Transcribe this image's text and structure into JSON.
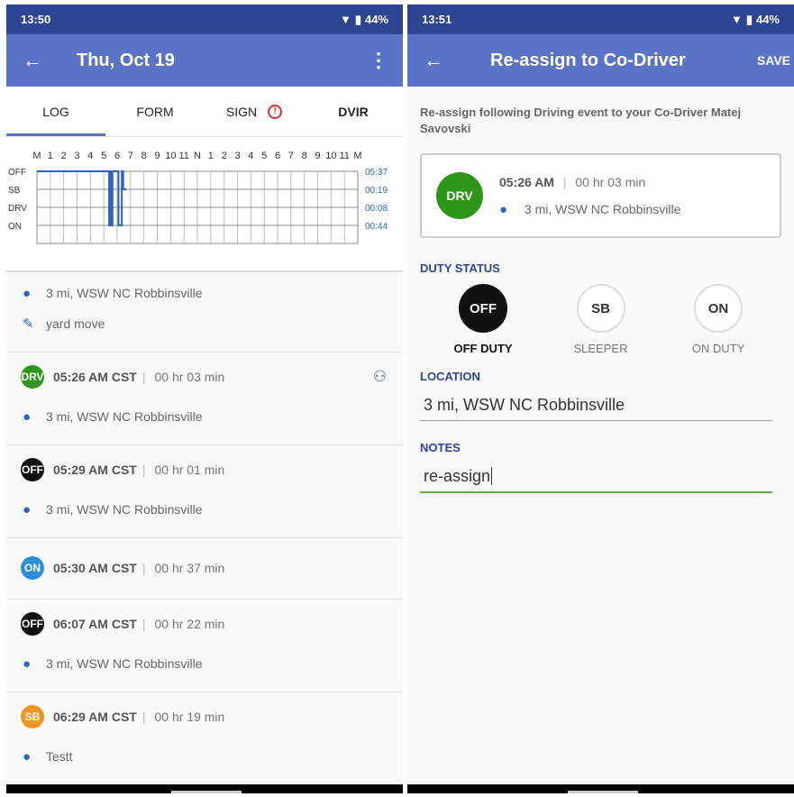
{
  "left": {
    "status_time": "13:50",
    "battery": "44%",
    "title": "Thu, Oct 19",
    "tabs": [
      "LOG",
      "FORM",
      "SIGN",
      "DVIR"
    ],
    "chart": {
      "hour_labels": [
        "M",
        "1",
        "2",
        "3",
        "4",
        "5",
        "6",
        "7",
        "8",
        "9",
        "10",
        "11",
        "N",
        "1",
        "2",
        "3",
        "4",
        "5",
        "6",
        "7",
        "8",
        "9",
        "10",
        "11",
        "M"
      ],
      "rows": [
        "OFF",
        "SB",
        "DRV",
        "ON"
      ],
      "totals": [
        "05:37",
        "00:19",
        "00:08",
        "00:44"
      ]
    },
    "top_block": {
      "location": "3 mi, WSW NC Robbinsville",
      "note": "yard move"
    },
    "events": [
      {
        "badge": "DRV",
        "color": "#2e9618",
        "time": "05:26 AM CST",
        "duration": "00 hr  03 min",
        "location": "3 mi, WSW NC Robbinsville"
      },
      {
        "badge": "OFF",
        "color": "#111111",
        "time": "05:29 AM CST",
        "duration": "00 hr  01 min",
        "location": "3 mi, WSW NC Robbinsville"
      },
      {
        "badge": "ON",
        "color": "#2b8fd6",
        "time": "05:30 AM CST",
        "duration": "00 hr  37 min",
        "location": ""
      },
      {
        "badge": "OFF",
        "color": "#111111",
        "time": "06:07 AM CST",
        "duration": "00 hr  22 min",
        "location": "3 mi, WSW NC Robbinsville"
      },
      {
        "badge": "SB",
        "color": "#f0961f",
        "time": "06:29 AM CST",
        "duration": "00 hr  19 min",
        "location": "Testt"
      }
    ]
  },
  "right": {
    "status_time": "13:51",
    "battery": "44%",
    "title": "Re-assign to Co-Driver",
    "save": "SAVE",
    "description": "Re-assign following Driving event to your Co-Driver Matej Savovski",
    "event": {
      "badge": "DRV",
      "time": "05:26 AM",
      "duration": "00 hr  03 min",
      "location": "3 mi, WSW NC Robbinsville"
    },
    "duty_label": "DUTY STATUS",
    "options": [
      {
        "code": "OFF",
        "label": "OFF DUTY",
        "selected": true
      },
      {
        "code": "SB",
        "label": "SLEEPER",
        "selected": false
      },
      {
        "code": "ON",
        "label": "ON DUTY",
        "selected": false
      }
    ],
    "location_label": "LOCATION",
    "location_value": "3 mi, WSW NC Robbinsville",
    "notes_label": "NOTES",
    "notes_value": "re-assign"
  },
  "colors": {
    "statusbar": "#2e4593",
    "appbar": "#5a73c6",
    "drv": "#2e9618",
    "on": "#2b8fd6",
    "sb": "#f0961f",
    "accent_blue": "#2e4593"
  },
  "icons": [
    "back-arrow-icon",
    "more-vert-icon",
    "wifi-icon",
    "battery-icon",
    "alert-icon",
    "location-pin-icon",
    "pencil-icon",
    "reassign-person-icon"
  ]
}
